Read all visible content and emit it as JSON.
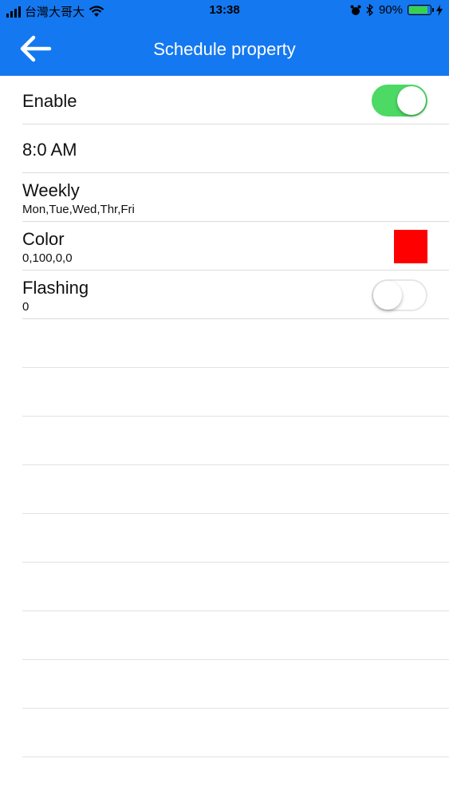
{
  "status_bar": {
    "carrier": "台灣大哥大",
    "time": "13:38",
    "battery_text": "90%",
    "battery_level": 0.9,
    "icons": [
      "signal-icon",
      "wifi-icon",
      "alarm-icon",
      "bluetooth-icon",
      "battery-icon",
      "charging-icon"
    ]
  },
  "header": {
    "title": "Schedule property",
    "back_icon": "arrow-left-icon"
  },
  "settings": {
    "enable": {
      "label": "Enable",
      "value": true
    },
    "time": {
      "label": "8:0 AM"
    },
    "weekly": {
      "label": "Weekly",
      "value": "Mon,Tue,Wed,Thr,Fri"
    },
    "color": {
      "label": "Color",
      "value": "0,100,0,0",
      "swatch": "#ff0000"
    },
    "flashing": {
      "label": "Flashing",
      "value": "0",
      "enabled": false
    }
  },
  "colors": {
    "primary": "#1478f0",
    "toggle_on": "#4cd964",
    "header_text": "#ffffff"
  }
}
